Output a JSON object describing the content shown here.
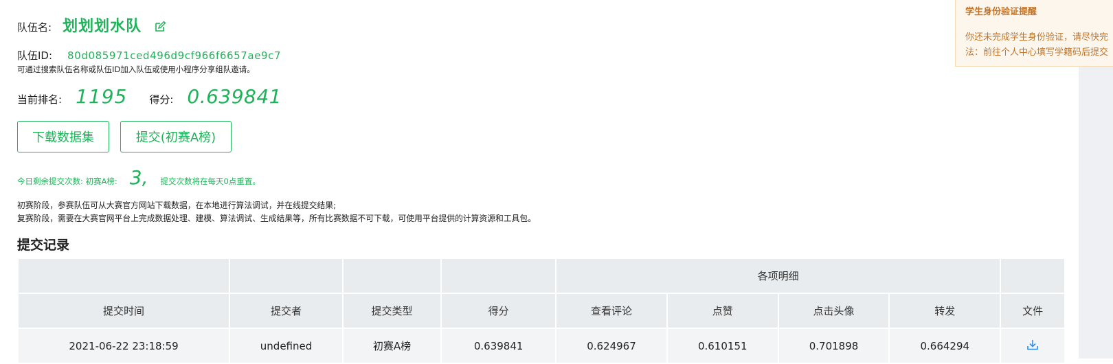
{
  "team": {
    "name_label": "队伍名:",
    "name": "划划划水队",
    "id_label": "队伍ID:",
    "id": "80d085971ced496d9cf966f6657ae9c7",
    "hint": "可通过搜索队伍名称或队伍ID加入队伍或使用小程序分享组队邀请。"
  },
  "ranking": {
    "rank_label": "当前排名:",
    "rank": "1195",
    "score_label": "得分:",
    "score": "0.639841"
  },
  "buttons": {
    "download": "下载数据集",
    "submit": "提交(初赛A榜)"
  },
  "remaining": {
    "prefix": "今日剩余提交次数: 初赛A榜:",
    "count": "3,",
    "suffix": "提交次数将在每天0点重置。"
  },
  "description": {
    "line1": "初赛阶段，参赛队伍可从大赛官方网站下载数据，在本地进行算法调试，并在线提交结果;",
    "line2": "复赛阶段，需要在大赛官网平台上完成数据处理、建模、算法调试、生成结果等，所有比赛数据不可下载，可使用平台提供的计算资源和工具包。"
  },
  "records": {
    "title": "提交记录",
    "group_header": "各项明细",
    "columns": [
      "提交时间",
      "提交者",
      "提交类型",
      "得分",
      "查看评论",
      "点赞",
      "点击头像",
      "转发",
      "文件"
    ],
    "rows": [
      {
        "time": "2021-06-22 23:18:59",
        "submitter": "undefined",
        "type": "初赛A榜",
        "score": "0.639841",
        "comment": "0.624967",
        "like": "0.610151",
        "avatar_click": "0.701898",
        "forward": "0.664294",
        "file_icon": "download-icon"
      }
    ]
  },
  "notice": {
    "title": "学生身份验证提醒",
    "line1": "你还未完成学生身份验证，请尽快完",
    "line2": "法：前往个人中心填写学籍码后提交"
  },
  "colors": {
    "accent": "#20b25a",
    "notice_text": "#c2752a",
    "notice_bg": "#fdf6ec",
    "table_header_bg": "#e9ecef"
  }
}
